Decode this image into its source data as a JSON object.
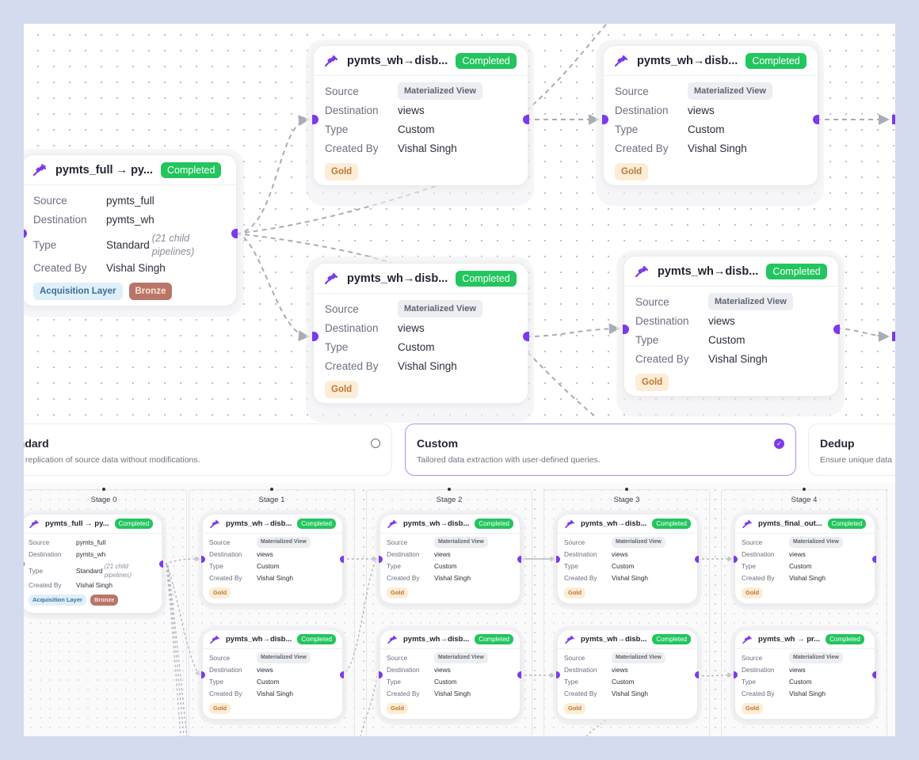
{
  "colors": {
    "accent": "#7c3aed",
    "completed": "#22c55e",
    "gold_bg": "#fdecd6",
    "bronze_bg": "#b97568",
    "acquisition_bg": "#dff0fb",
    "page_bg": "#d3dbee"
  },
  "labels": {
    "source": "Source",
    "destination": "Destination",
    "type": "Type",
    "created_by": "Created By"
  },
  "icon": "plug-connection-icon",
  "top_graph": {
    "nodes": [
      {
        "id": "root",
        "title": "pymts_full → py...",
        "status": "Completed",
        "source": "pymts_full",
        "destination": "pymts_wh",
        "type": "Standard",
        "type_note": "(21 child pipelines)",
        "created_by": "Vishal Singh",
        "tags": [
          "Acquisition Layer",
          "Bronze"
        ]
      },
      {
        "id": "n1",
        "title": "pymts_wh→disb...",
        "status": "Completed",
        "source": "Materialized View",
        "destination": "views",
        "type": "Custom",
        "created_by": "Vishal Singh",
        "tags": [
          "Gold"
        ]
      },
      {
        "id": "n2",
        "title": "pymts_wh→disb...",
        "status": "Completed",
        "source": "Materialized View",
        "destination": "views",
        "type": "Custom",
        "created_by": "Vishal Singh",
        "tags": [
          "Gold"
        ]
      },
      {
        "id": "n3",
        "title": "pymts_wh→disb...",
        "status": "Completed",
        "source": "Materialized View",
        "destination": "views",
        "type": "Custom",
        "created_by": "Vishal Singh",
        "tags": [
          "Gold"
        ]
      },
      {
        "id": "n4",
        "title": "pymts_wh→disb...",
        "status": "Completed",
        "source": "Materialized View",
        "destination": "views",
        "type": "Custom",
        "created_by": "Vishal Singh",
        "tags": [
          "Gold"
        ]
      }
    ]
  },
  "pipeline_types": [
    {
      "title": "Standard",
      "visible_title": "andard",
      "description": "Direct replication of source data without modifications.",
      "visible_description": "ect replication of source data without modifications.",
      "selected": false
    },
    {
      "title": "Custom",
      "visible_title": "Custom",
      "description": "Tailored data extraction with user-defined queries.",
      "visible_description": "Tailored data extraction with user-defined queries.",
      "selected": true
    },
    {
      "title": "Dedup",
      "visible_title": "Dedup",
      "description": "Ensure unique data",
      "visible_description": "Ensure unique data",
      "selected": false
    }
  ],
  "stages": [
    {
      "label": "Stage 0",
      "nodes": [
        {
          "title": "pymts_full → py...",
          "status": "Completed",
          "source": "pymts_full",
          "destination": "pymts_wh",
          "type": "Standard",
          "type_note": "(21 child pipelines)",
          "created_by": "Vishal Singh",
          "tags": [
            "Acquisition Layer",
            "Bronze"
          ]
        }
      ]
    },
    {
      "label": "Stage 1",
      "nodes": [
        {
          "title": "pymts_wh→disb...",
          "status": "Completed",
          "source": "Materialized View",
          "destination": "views",
          "type": "Custom",
          "created_by": "Vishal Singh",
          "tags": [
            "Gold"
          ]
        },
        {
          "title": "pymts_wh→disb...",
          "status": "Completed",
          "source": "Materialized View",
          "destination": "views",
          "type": "Custom",
          "created_by": "Vishal Singh",
          "tags": [
            "Gold"
          ]
        }
      ]
    },
    {
      "label": "Stage 2",
      "nodes": [
        {
          "title": "pymts_wh→disb...",
          "status": "Completed",
          "source": "Materialized View",
          "destination": "views",
          "type": "Custom",
          "created_by": "Vishal Singh",
          "tags": [
            "Gold"
          ]
        },
        {
          "title": "pymts_wh→disb...",
          "status": "Completed",
          "source": "Materialized View",
          "destination": "views",
          "type": "Custom",
          "created_by": "Vishal Singh",
          "tags": [
            "Gold"
          ]
        }
      ]
    },
    {
      "label": "Stage 3",
      "nodes": [
        {
          "title": "pymts_wh→disb...",
          "status": "Completed",
          "source": "Materialized View",
          "destination": "views",
          "type": "Custom",
          "created_by": "Vishal Singh",
          "tags": [
            "Gold"
          ]
        },
        {
          "title": "pymts_wh→disb...",
          "status": "Completed",
          "source": "Materialized View",
          "destination": "views",
          "type": "Custom",
          "created_by": "Vishal Singh",
          "tags": [
            "Gold"
          ]
        }
      ]
    },
    {
      "label": "Stage 4",
      "nodes": [
        {
          "title": "pymts_final_out...",
          "status": "Completed",
          "source": "Materialized View",
          "destination": "views",
          "type": "Custom",
          "created_by": "Vishal Singh",
          "tags": [
            "Gold"
          ]
        },
        {
          "title": "pymts_wh → pr...",
          "status": "Completed",
          "source": "Materialized View",
          "destination": "views",
          "type": "Custom",
          "created_by": "Vishal Singh",
          "tags": [
            "Gold"
          ]
        }
      ]
    }
  ]
}
